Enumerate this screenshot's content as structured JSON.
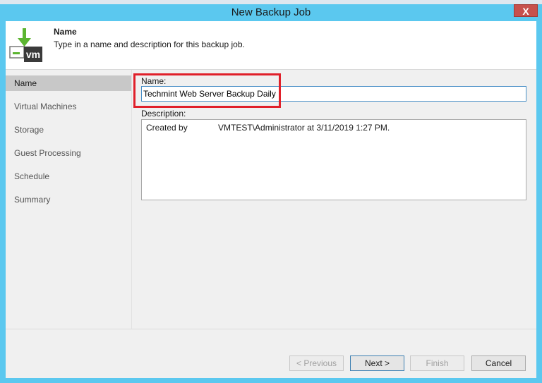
{
  "window": {
    "title": "New Backup Job",
    "close_label": "X"
  },
  "header": {
    "title": "Name",
    "description": "Type in a name and description for this backup job.",
    "logo_text": "vm"
  },
  "nav": {
    "items": [
      {
        "label": "Name",
        "active": true
      },
      {
        "label": "Virtual Machines",
        "active": false
      },
      {
        "label": "Storage",
        "active": false
      },
      {
        "label": "Guest Processing",
        "active": false
      },
      {
        "label": "Schedule",
        "active": false
      },
      {
        "label": "Summary",
        "active": false
      }
    ]
  },
  "form": {
    "name_label": "Name:",
    "name_value": "Techmint Web Server Backup Daily",
    "description_label": "Description:",
    "description_value": "Created by             VMTEST\\Administrator at 3/11/2019 1:27 PM."
  },
  "buttons": {
    "previous": "< Previous",
    "next": "Next >",
    "finish": "Finish",
    "cancel": "Cancel"
  },
  "colors": {
    "frame": "#5bc8ef",
    "highlight": "#e0202a",
    "logo_green": "#5cb531",
    "logo_dark": "#3a3a3a"
  }
}
